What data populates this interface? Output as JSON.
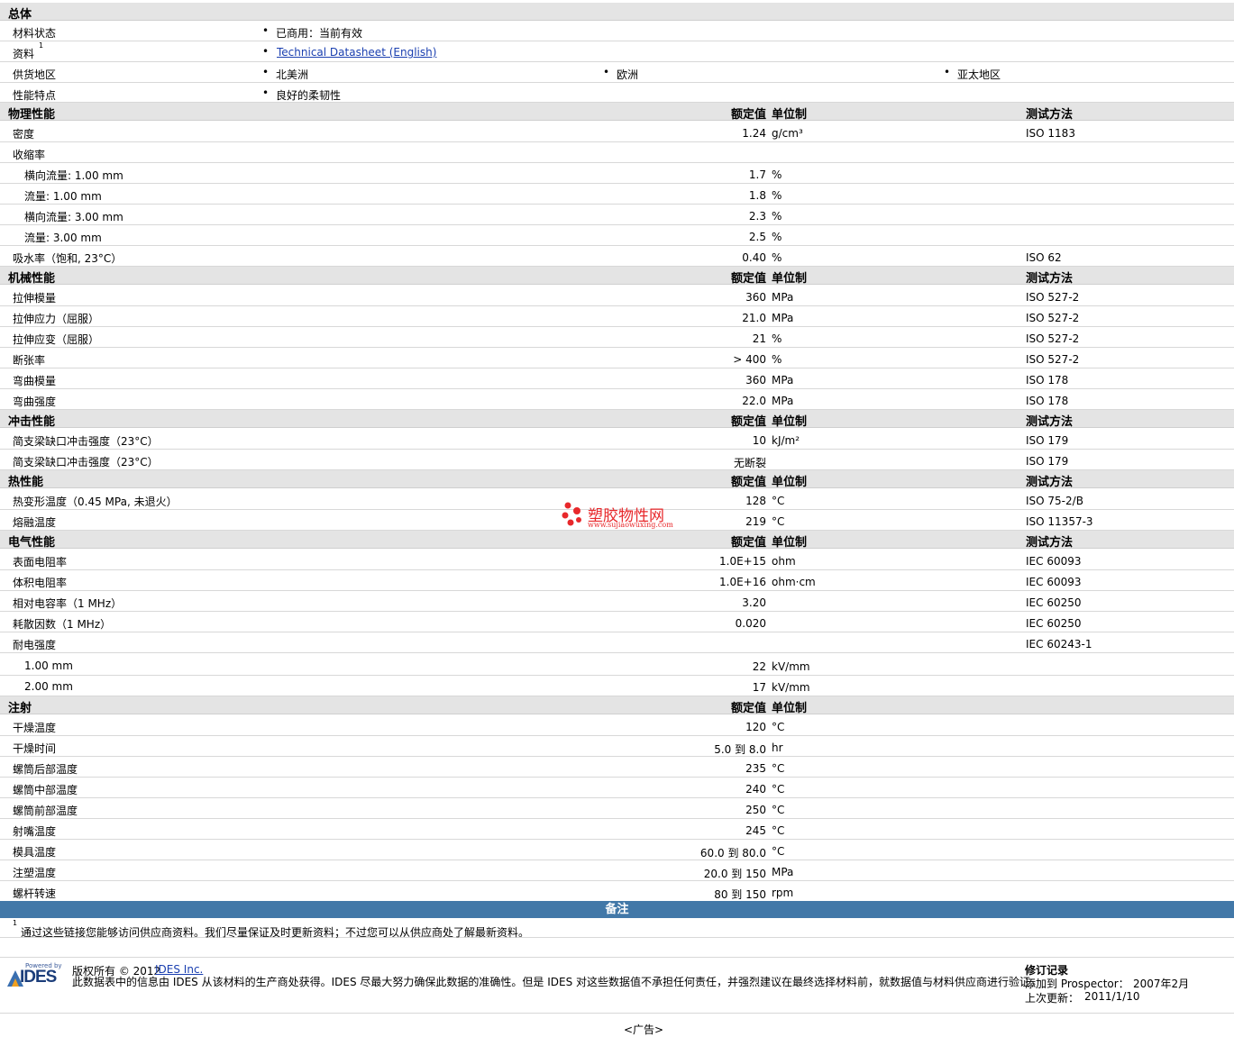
{
  "overview": {
    "title": "总体",
    "rows": [
      {
        "label": "材料状态",
        "items": [
          "已商用：当前有效"
        ]
      },
      {
        "label": "资料",
        "sup": "1",
        "link": "Technical Datasheet (English)"
      },
      {
        "label": "供货地区",
        "items": [
          "北美洲",
          "欧洲",
          "亚太地区"
        ]
      },
      {
        "label": "性能特点",
        "items": [
          "良好的柔韧性"
        ]
      }
    ]
  },
  "col_headers": {
    "value": "额定值",
    "unit": "单位制",
    "method": "测试方法"
  },
  "sections": [
    {
      "title": "物理性能",
      "method_header": true,
      "rows": [
        {
          "label": "密度",
          "value": "1.24",
          "unit": "g/cm³",
          "method": "ISO 1183"
        },
        {
          "label": "收缩率",
          "value": "",
          "unit": "",
          "method": ""
        },
        {
          "label": "横向流量: 1.00 mm",
          "indent": true,
          "value": "1.7",
          "unit": "%",
          "method": ""
        },
        {
          "label": "流量: 1.00 mm",
          "indent": true,
          "value": "1.8",
          "unit": "%",
          "method": ""
        },
        {
          "label": "横向流量: 3.00 mm",
          "indent": true,
          "value": "2.3",
          "unit": "%",
          "method": ""
        },
        {
          "label": "流量: 3.00 mm",
          "indent": true,
          "value": "2.5",
          "unit": "%",
          "method": ""
        },
        {
          "label": "吸水率（饱和, 23°C）",
          "value": "0.40",
          "unit": "%",
          "method": "ISO 62"
        }
      ]
    },
    {
      "title": "机械性能",
      "method_header": true,
      "rows": [
        {
          "label": "拉伸模量",
          "value": "360",
          "unit": "MPa",
          "method": "ISO 527-2"
        },
        {
          "label": "拉伸应力（屈服）",
          "value": "21.0",
          "unit": "MPa",
          "method": "ISO 527-2"
        },
        {
          "label": "拉伸应变（屈服）",
          "value": "21",
          "unit": "%",
          "method": "ISO 527-2"
        },
        {
          "label": "断张率",
          "value": "> 400",
          "unit": "%",
          "method": "ISO 527-2"
        },
        {
          "label": "弯曲模量",
          "value": "360",
          "unit": "MPa",
          "method": "ISO 178"
        },
        {
          "label": "弯曲强度",
          "value": "22.0",
          "unit": "MPa",
          "method": "ISO 178"
        }
      ]
    },
    {
      "title": "冲击性能",
      "method_header": true,
      "rows": [
        {
          "label": "简支梁缺口冲击强度（23°C）",
          "value": "10",
          "unit": "kJ/m²",
          "method": "ISO 179"
        },
        {
          "label": "简支梁缺口冲击强度（23°C）",
          "value": "无断裂",
          "unit": "",
          "method": "ISO 179"
        }
      ]
    },
    {
      "title": "热性能",
      "method_header": true,
      "rows": [
        {
          "label": "热变形温度（0.45 MPa, 未退火）",
          "value": "128",
          "unit": "°C",
          "method": "ISO 75-2/B"
        },
        {
          "label": "熔融温度",
          "value": "219",
          "unit": "°C",
          "method": "ISO 11357-3"
        }
      ]
    },
    {
      "title": "电气性能",
      "method_header": true,
      "rows": [
        {
          "label": "表面电阻率",
          "value": "1.0E+15",
          "unit": "ohm",
          "method": "IEC 60093"
        },
        {
          "label": "体积电阻率",
          "value": "1.0E+16",
          "unit": "ohm·cm",
          "method": "IEC 60093"
        },
        {
          "label": "相对电容率（1 MHz）",
          "value": "3.20",
          "unit": "",
          "method": "IEC 60250"
        },
        {
          "label": "耗散因数（1 MHz）",
          "value": "0.020",
          "unit": "",
          "method": "IEC 60250"
        },
        {
          "label": "耐电强度",
          "value": "",
          "unit": "",
          "method": "IEC 60243-1"
        },
        {
          "label": "1.00 mm",
          "indent": true,
          "value": "22",
          "unit": "kV/mm",
          "method": ""
        },
        {
          "label": "2.00 mm",
          "indent": true,
          "value": "17",
          "unit": "kV/mm",
          "method": ""
        }
      ]
    },
    {
      "title": "注射",
      "method_header": false,
      "rows": [
        {
          "label": "干燥温度",
          "value": "120",
          "unit": "°C",
          "method": ""
        },
        {
          "label": "干燥时间",
          "value": "5.0 到  8.0",
          "unit": "hr",
          "method": ""
        },
        {
          "label": "螺筒后部温度",
          "value": "235",
          "unit": "°C",
          "method": ""
        },
        {
          "label": "螺筒中部温度",
          "value": "240",
          "unit": "°C",
          "method": ""
        },
        {
          "label": "螺筒前部温度",
          "value": "250",
          "unit": "°C",
          "method": ""
        },
        {
          "label": "射嘴温度",
          "value": "245",
          "unit": "°C",
          "method": ""
        },
        {
          "label": "模具温度",
          "value": "60.0 到  80.0",
          "unit": "°C",
          "method": ""
        },
        {
          "label": "注塑温度",
          "value": "20.0 到  150",
          "unit": "MPa",
          "method": ""
        },
        {
          "label": "螺杆转速",
          "value": "80 到  150",
          "unit": "rpm",
          "method": ""
        }
      ]
    }
  ],
  "remarks": {
    "title": "备注",
    "note_sup": "1",
    "note": "通过这些链接您能够访问供应商资料。我们尽量保证及时更新资料；不过您可以从供应商处了解最新资料。"
  },
  "footer": {
    "logo_small": "Powered by",
    "logo_text": "IDES",
    "copyright": "版权所有  © 2012",
    "company_link": "IDES Inc.",
    "disclaimer": "此数据表中的信息由  IDES 从该材料的生产商处获得。IDES 尽最大努力确保此数据的准确性。但是  IDES 对这些数据值不承担任何责任，并强烈建议在最终选择材料前，就数据值与材料供应商进行验证。",
    "revision_title": "修订记录",
    "added_label": "添加到  Prospector：",
    "added_value": "2007年2月",
    "updated_label": "上次更新：",
    "updated_value": "2011/1/10",
    "ad": "<广告>"
  },
  "watermark": {
    "cn": "塑胶物性网",
    "url": "www.sujiaowuxing.com"
  },
  "colors": {
    "section_bg": "#e4e4e4",
    "remarks_bg": "#4278a8",
    "link": "#1a3fb0",
    "watermark": "#e8282b"
  }
}
